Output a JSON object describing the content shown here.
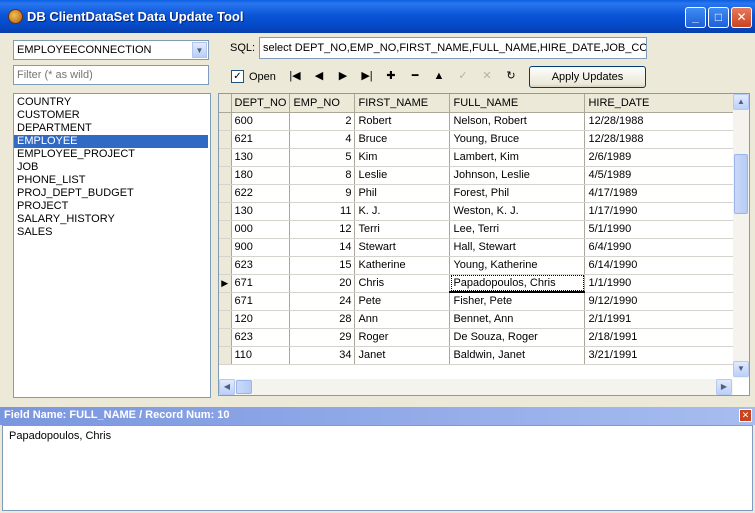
{
  "window": {
    "title": "DB ClientDataSet Data Update Tool",
    "controls": [
      "_",
      "□",
      "✕"
    ]
  },
  "connection": {
    "selected": "EMPLOYEECONNECTION",
    "dropdown_icon": "▼"
  },
  "filter": {
    "placeholder": "Filter (* as wild)"
  },
  "tables": {
    "items": [
      "COUNTRY",
      "CUSTOMER",
      "DEPARTMENT",
      "EMPLOYEE",
      "EMPLOYEE_PROJECT",
      "JOB",
      "PHONE_LIST",
      "PROJ_DEPT_BUDGET",
      "PROJECT",
      "SALARY_HISTORY",
      "SALES"
    ],
    "selected_index": 3
  },
  "sql": {
    "label": "SQL:",
    "value": "select DEPT_NO,EMP_NO,FIRST_NAME,FULL_NAME,HIRE_DATE,JOB_CODE,JOB_GRADE"
  },
  "toolbar": {
    "open_label": "Open",
    "open_checked": true,
    "check_glyph": "✓",
    "nav": [
      {
        "name": "first-record",
        "glyph": "|◀",
        "enabled": true
      },
      {
        "name": "prior-record",
        "glyph": "◀",
        "enabled": true
      },
      {
        "name": "next-record",
        "glyph": "▶",
        "enabled": true
      },
      {
        "name": "last-record",
        "glyph": "▶|",
        "enabled": true
      },
      {
        "name": "insert-record",
        "glyph": "✚",
        "enabled": true
      },
      {
        "name": "delete-record",
        "glyph": "━",
        "enabled": true
      },
      {
        "name": "edit-record",
        "glyph": "▲",
        "enabled": true
      },
      {
        "name": "post-edit",
        "glyph": "✓",
        "enabled": false
      },
      {
        "name": "cancel-edit",
        "glyph": "✕",
        "enabled": false
      },
      {
        "name": "refresh-data",
        "glyph": "↻",
        "enabled": true
      }
    ],
    "apply_label": "Apply Updates"
  },
  "grid": {
    "columns": [
      "DEPT_NO",
      "EMP_NO",
      "FIRST_NAME",
      "FULL_NAME",
      "HIRE_DATE"
    ],
    "current_row": 9,
    "current_indicator": "▶",
    "rows": [
      [
        "600",
        "2",
        "Robert",
        "Nelson, Robert",
        "12/28/1988"
      ],
      [
        "621",
        "4",
        "Bruce",
        "Young, Bruce",
        "12/28/1988"
      ],
      [
        "130",
        "5",
        "Kim",
        "Lambert, Kim",
        "2/6/1989"
      ],
      [
        "180",
        "8",
        "Leslie",
        "Johnson, Leslie",
        "4/5/1989"
      ],
      [
        "622",
        "9",
        "Phil",
        "Forest, Phil",
        "4/17/1989"
      ],
      [
        "130",
        "11",
        "K. J.",
        "Weston, K. J.",
        "1/17/1990"
      ],
      [
        "000",
        "12",
        "Terri",
        "Lee, Terri",
        "5/1/1990"
      ],
      [
        "900",
        "14",
        "Stewart",
        "Hall, Stewart",
        "6/4/1990"
      ],
      [
        "623",
        "15",
        "Katherine",
        "Young, Katherine",
        "6/14/1990"
      ],
      [
        "671",
        "20",
        "Chris",
        "Papadopoulos, Chris",
        "1/1/1990"
      ],
      [
        "671",
        "24",
        "Pete",
        "Fisher, Pete",
        "9/12/1990"
      ],
      [
        "120",
        "28",
        "Ann",
        "Bennet, Ann",
        "2/1/1991"
      ],
      [
        "623",
        "29",
        "Roger",
        "De Souza, Roger",
        "2/18/1991"
      ],
      [
        "110",
        "34",
        "Janet",
        "Baldwin, Janet",
        "3/21/1991"
      ]
    ]
  },
  "field_panel": {
    "header": "Field Name: FULL_NAME / Record Num: 10",
    "value": "Papadopoulos, Chris",
    "close_glyph": "✕"
  },
  "scroll_glyphs": {
    "up": "▲",
    "down": "▼",
    "left": "◀",
    "right": "▶"
  }
}
